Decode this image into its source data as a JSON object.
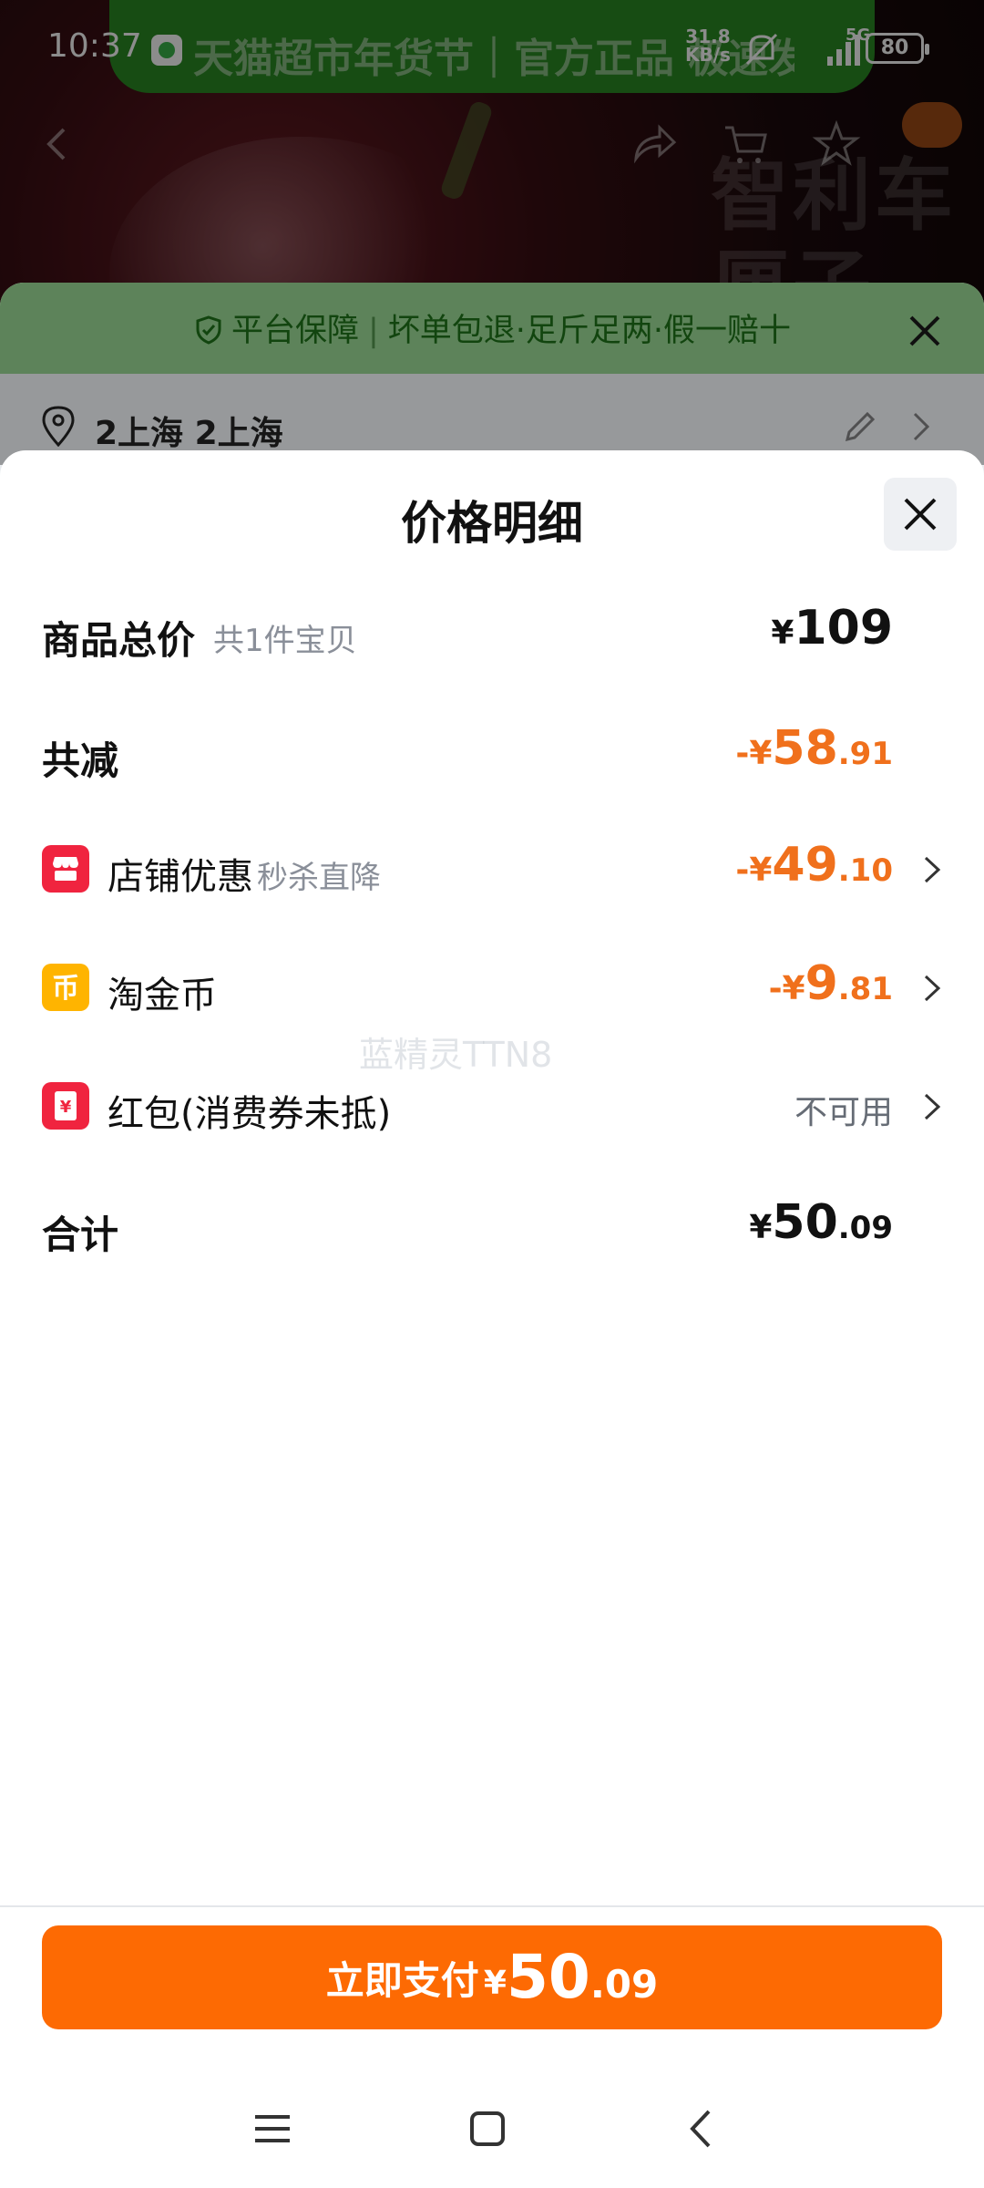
{
  "status_bar": {
    "time": "10:37",
    "notification_text": "天猫超市年货节｜官方正品 极速发货",
    "net_speed_value": "31.8",
    "net_speed_unit": "KB/s",
    "network": "5G",
    "battery": "80"
  },
  "background": {
    "promo_text": "智利车厘子",
    "guarantee_label": "平台保障",
    "guarantee_text": "坏单包退·足斤足两·假一赔十",
    "address": "2上海 2上海"
  },
  "sheet": {
    "title": "价格明细",
    "total_row": {
      "label": "商品总价",
      "sub": "共1件宝贝",
      "currency": "¥",
      "int": "109",
      "dec": ""
    },
    "discount_row": {
      "label": "共减",
      "prefix": "-¥",
      "int": "58",
      "dec": ".91"
    },
    "shop_row": {
      "label": "店铺优惠",
      "sub": "秒杀直降",
      "prefix": "-¥",
      "int": "49",
      "dec": ".10"
    },
    "coin_row": {
      "label": "淘金币",
      "prefix": "-¥",
      "int": "9",
      "dec": ".81"
    },
    "redpacket_row": {
      "label": "红包(消费券未抵)",
      "value": "不可用"
    },
    "sum_row": {
      "label": "合计",
      "currency": "¥",
      "int": "50",
      "dec": ".09"
    },
    "watermark": "蓝精灵TTN8"
  },
  "pay_button": {
    "label": "立即支付",
    "currency": "¥",
    "int": "50",
    "dec": ".09"
  },
  "colors": {
    "accent": "#fd6a03",
    "discount": "#f0701c",
    "shop_icon": "#f0243f",
    "coin_icon": "#ffb400"
  }
}
